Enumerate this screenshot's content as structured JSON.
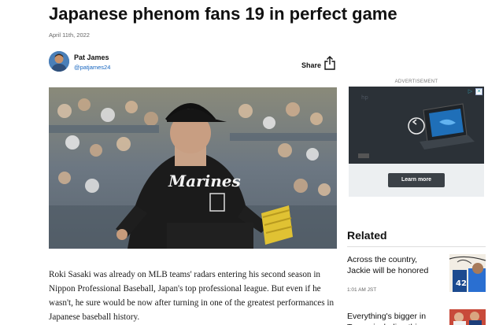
{
  "article": {
    "title": "Japanese phenom fans 19 in perfect game",
    "date": "April 11th, 2022",
    "author": {
      "name": "Pat James",
      "handle": "@patjames24"
    },
    "share_label": "Share",
    "body": "Roki Sasaki was already on MLB teams' radars entering his second season in Nippon Professional Baseball, Japan's top professional league. But even if he wasn't, he sure would be now after turning in one of the greatest performances in Japanese baseball history.",
    "hero_jersey_text": "Marines"
  },
  "sidebar": {
    "ad": {
      "label": "ADVERTISEMENT",
      "button_label": "Learn more",
      "close_symbol": "✕",
      "adchoices_symbol": "▷"
    },
    "related": {
      "heading": "Related",
      "items": [
        {
          "title": "Across the country, Jackie will be honored",
          "time": "1:01 AM JST"
        },
        {
          "title": "Everything's bigger in Texas, including this",
          "time": ""
        }
      ]
    }
  },
  "colors": {
    "link": "#1565c0",
    "ad_button": "#3b4147",
    "text": "#111111"
  }
}
